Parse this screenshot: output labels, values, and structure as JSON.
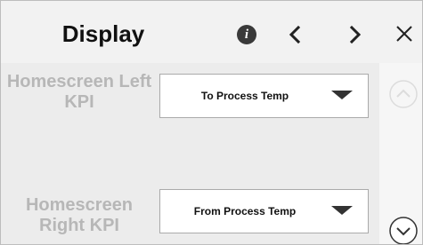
{
  "header": {
    "title": "Display",
    "icons": [
      "info-icon",
      "chevron-left-icon",
      "chevron-right-icon",
      "close-icon"
    ]
  },
  "settings": [
    {
      "label": "Homescreen Left KPI",
      "value": "To Process Temp"
    },
    {
      "label": "Homescreen Right KPI",
      "value": "From Process Temp"
    }
  ],
  "scroll": {
    "up_icon": "chevron-up-circle-icon",
    "down_icon": "chevron-down-circle-icon"
  },
  "colors": {
    "background": "#f2f2f2",
    "label_text": "#b7b7b7",
    "select_bg": "#ffffff"
  }
}
